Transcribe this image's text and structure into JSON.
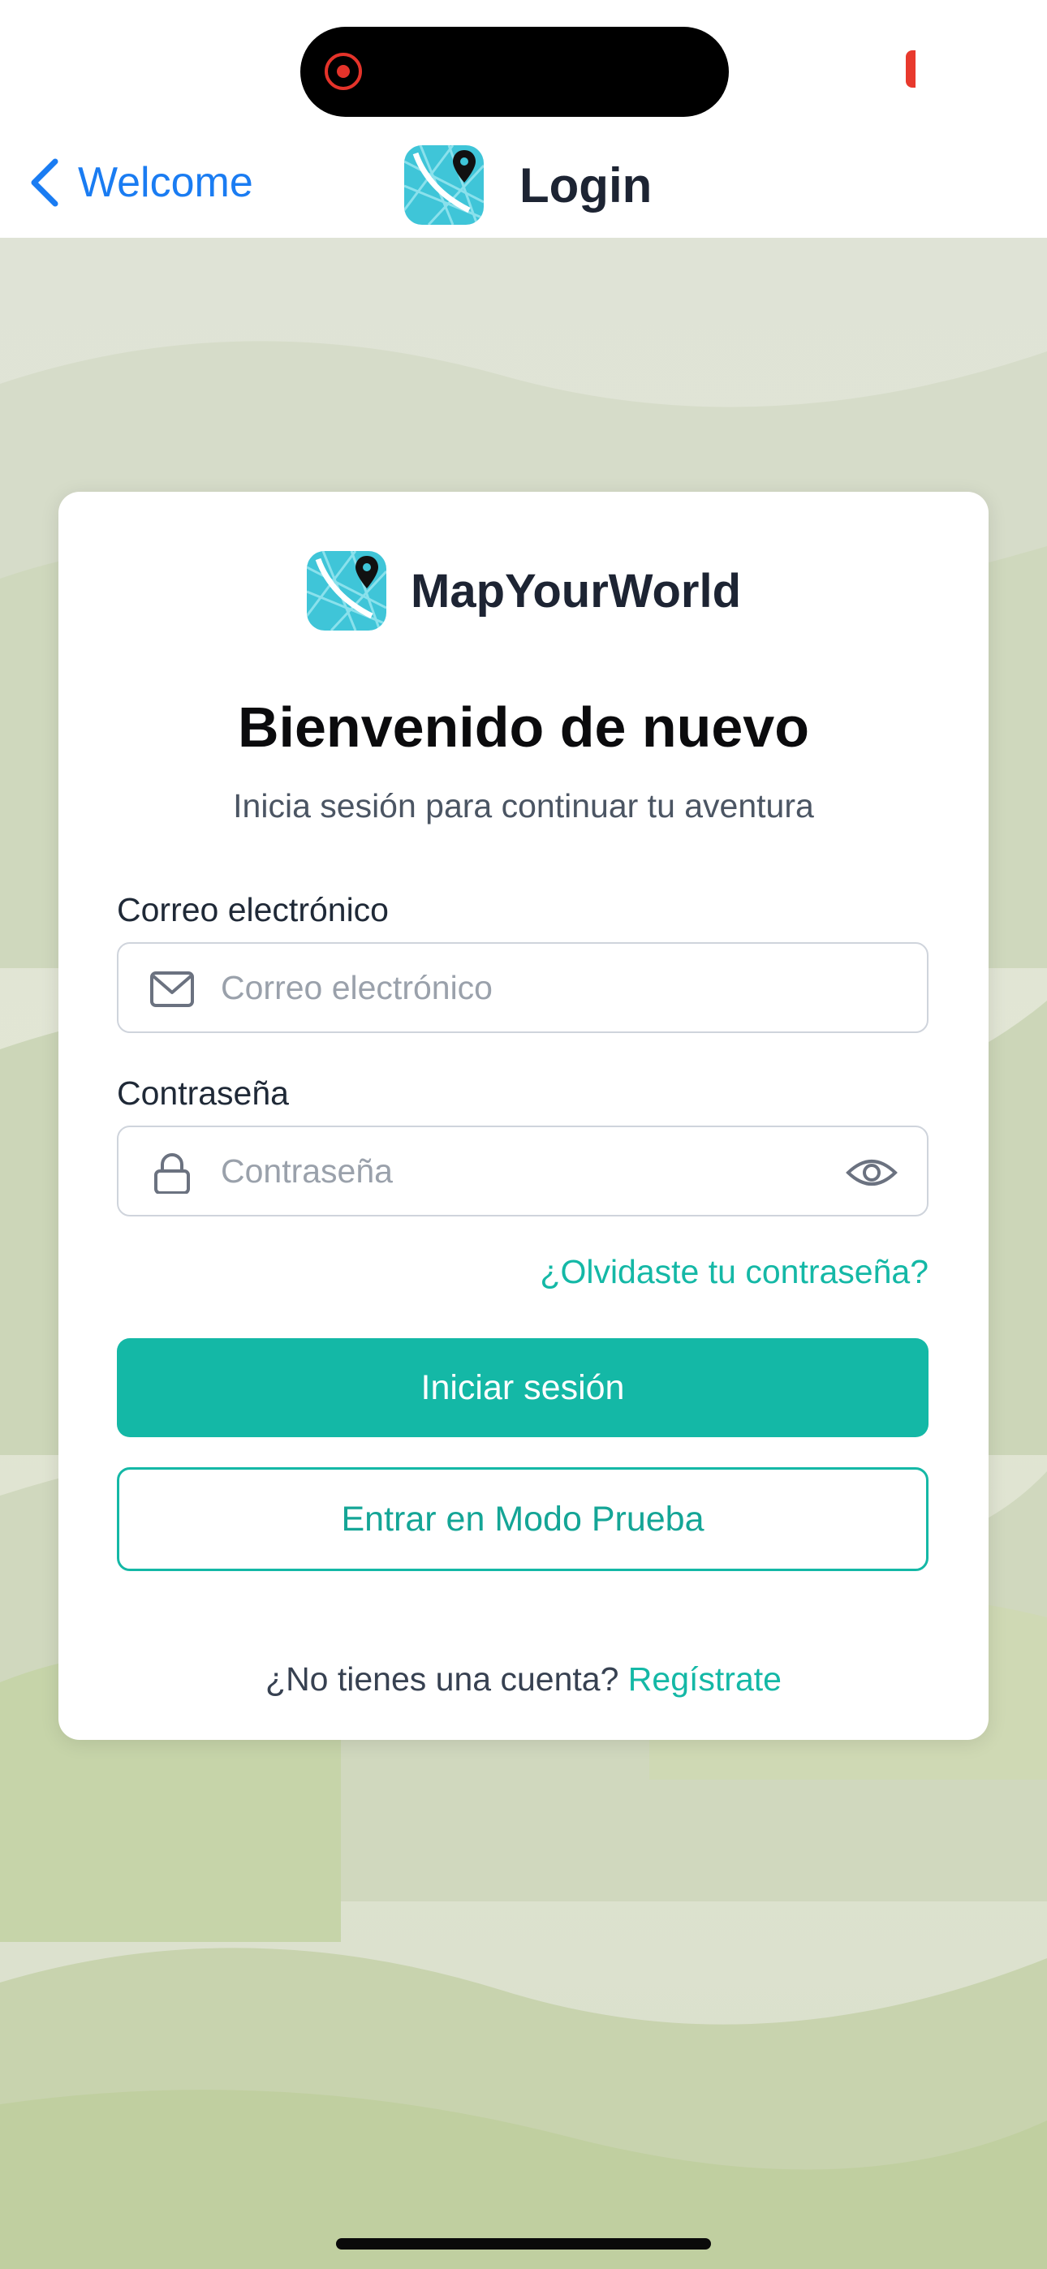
{
  "nav": {
    "back_label": "Welcome",
    "title": "Login"
  },
  "card": {
    "brand_name": "MapYourWorld",
    "heading": "Bienvenido de nuevo",
    "subheading": "Inicia sesión para continuar tu aventura",
    "email": {
      "label": "Correo electrónico",
      "placeholder": "Correo electrónico",
      "value": ""
    },
    "password": {
      "label": "Contraseña",
      "placeholder": "Contraseña",
      "value": ""
    },
    "forgot_link": "¿Olvidaste tu contraseña?",
    "login_button": "Iniciar sesión",
    "test_mode_button": "Entrar en Modo Prueba",
    "signup_prompt": "¿No tienes una cuenta?",
    "signup_link": "Regístrate"
  },
  "icons": {
    "back": "chevron-left-icon",
    "app_logo": "map-pin-logo-icon",
    "email": "envelope-icon",
    "password": "lock-icon",
    "visibility": "eye-icon",
    "recording": "screen-recording-icon"
  },
  "colors": {
    "accent": "#14b8a6",
    "link_blue": "#1a7cf2",
    "heading": "#0b0b0d",
    "text_muted": "#4b5563"
  }
}
